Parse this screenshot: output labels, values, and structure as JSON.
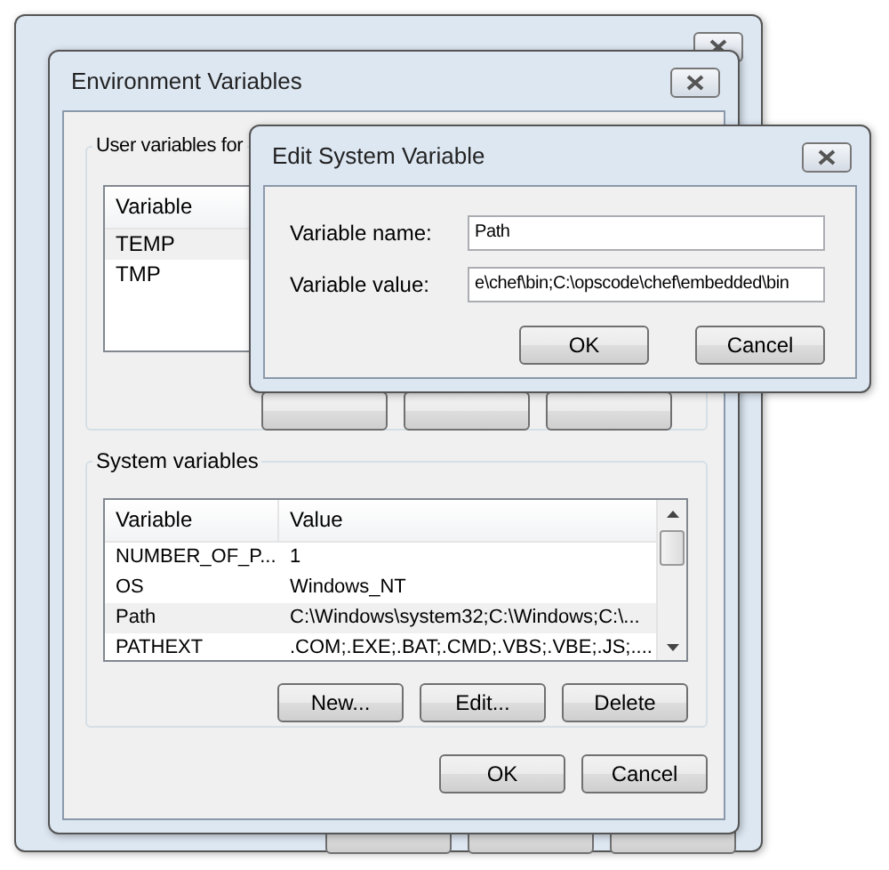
{
  "system_properties": {
    "kind": "window"
  },
  "environment_variables": {
    "title": "Environment Variables",
    "user_variables": {
      "label": "User variables for",
      "columns": [
        "Variable"
      ],
      "rows": [
        {
          "variable": "TEMP",
          "selected": true
        },
        {
          "variable": "TMP",
          "selected": false
        }
      ]
    },
    "system_variables": {
      "label": "System variables",
      "columns": [
        "Variable",
        "Value"
      ],
      "rows": [
        {
          "variable": "NUMBER_OF_P...",
          "value": "1",
          "selected": false
        },
        {
          "variable": "OS",
          "value": "Windows_NT",
          "selected": false
        },
        {
          "variable": "Path",
          "value": "C:\\Windows\\system32;C:\\Windows;C:\\...",
          "selected": true
        },
        {
          "variable": "PATHEXT",
          "value": ".COM;.EXE;.BAT;.CMD;.VBS;.VBE;.JS;....",
          "selected": false
        }
      ],
      "buttons": [
        "New...",
        "Edit...",
        "Delete"
      ]
    },
    "buttons": [
      "OK",
      "Cancel"
    ]
  },
  "edit_dialog": {
    "title": "Edit System Variable",
    "fields": [
      {
        "label": "Variable name:",
        "value": "Path"
      },
      {
        "label": "Variable value:",
        "value": "e\\chef\\bin;C:\\opscode\\chef\\embedded\\bin"
      }
    ],
    "buttons": [
      "OK",
      "Cancel"
    ]
  }
}
